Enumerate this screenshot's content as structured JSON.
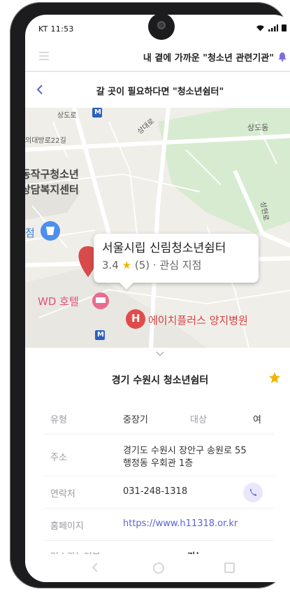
{
  "status": {
    "carrier_time": "KT 11:53"
  },
  "appbar": {
    "title": "내 곁에 가까운 \"청소년 관련기관\"",
    "menu_icon": "hamburger-menu-icon",
    "bell_icon": "bell-icon"
  },
  "subbar": {
    "title": "갈 곳이 필요하다면 \"청소년쉼터\"",
    "back_icon": "chevron-left-icon"
  },
  "map": {
    "labels": {
      "road_top": "상도로",
      "dong_right": "상도동",
      "road_22": "의대방로22길",
      "sangdaero": "상대로",
      "center_1": "동작구청소년",
      "center_2": "상담복지센터",
      "jeom": "점",
      "hotel": "WD 호텔",
      "hospital": "에이치플러스 양지병원",
      "hospital_badge": "H",
      "metro_badge": "M",
      "road_side": "성현로"
    },
    "callout": {
      "name": "서울시립 신림청소년쉼터",
      "rating": "3.4",
      "star": "★",
      "reviews": "(5)",
      "suffix": " · 관심 지점"
    }
  },
  "sheet": {
    "title": "경기 수원시 청소년쉼터",
    "rows": {
      "type_label": "유형",
      "type_value": "중장기",
      "target_label": "대상",
      "target_value": "여",
      "address_label": "주소",
      "address_line1": "경기도 수원시 장안구 송원로 55",
      "address_line2": "행정동 우회관 1층",
      "contact_label": "연락처",
      "contact_value": "031-248-1318",
      "homepage_label": "홈페이지",
      "homepage_value": "https://www.h11318.or.kr",
      "admission_label": "입소가능여부",
      "admission_value": "가능"
    }
  },
  "colors": {
    "accent": "#5b63d8",
    "star": "#f4b400",
    "map_pin": "#d94a4a"
  }
}
